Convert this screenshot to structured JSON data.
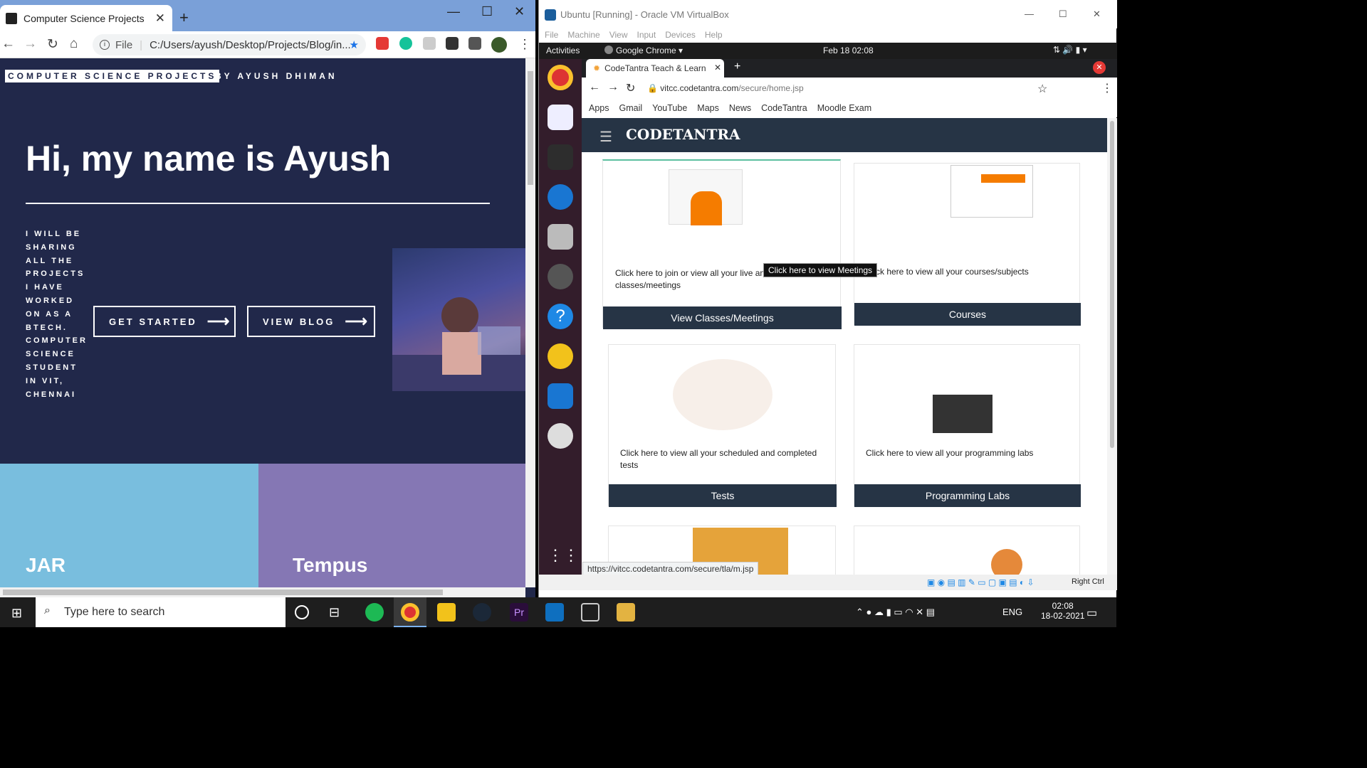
{
  "left_window": {
    "tab_title": "Computer Science Projects",
    "address": "C:/Users/ayush/Desktop/Projects/Blog/in...",
    "address_prefix": "File",
    "site": {
      "logo": "COMPUTER SCIENCE PROJECTS",
      "byline": "BY AYUSH DHIMAN",
      "hero": "Hi, my name is Ayush",
      "tagline": "I WILL BE SHARING ALL THE PROJECTS I HAVE WORKED ON AS A BTECH. COMPUTER SCIENCE STUDENT IN VIT, CHENNAI",
      "cta_primary": "GET STARTED",
      "cta_secondary": "VIEW BLOG",
      "tile_1": "JAR",
      "tile_2": "Tempus"
    }
  },
  "right_window": {
    "title": "Ubuntu [Running] - Oracle VM VirtualBox",
    "menu": [
      "File",
      "Machine",
      "View",
      "Input",
      "Devices",
      "Help"
    ],
    "gnome": {
      "activities": "Activities",
      "app": "Google Chrome ▾",
      "clock": "Feb 18  02:08"
    },
    "chrome": {
      "tab_title": "CodeTantra Teach & Learn",
      "url_host": "vitcc.codetantra.com",
      "url_path": "/secure/home.jsp",
      "bookmarks": [
        "Apps",
        "Gmail",
        "YouTube",
        "Maps",
        "News",
        "CodeTantra",
        "Moodle Exam"
      ]
    },
    "codetantra": {
      "logo": "CODETANTRA",
      "cards": [
        {
          "text": "Click here to join or view all your live and classes/meetings",
          "button": "View Classes/Meetings"
        },
        {
          "text": "Click here to view all your courses/subjects",
          "button": "Courses"
        },
        {
          "text": "Click here to view all your scheduled and completed tests",
          "button": "Tests"
        },
        {
          "text": "Click here to view all your programming labs",
          "button": "Programming Labs"
        }
      ],
      "tooltip": "Click here to view Meetings",
      "status_url": "https://vitcc.codetantra.com/secure/tla/m.jsp"
    },
    "host_key": "Right Ctrl"
  },
  "taskbar": {
    "search_placeholder": "Type here to search",
    "language": "ENG",
    "time": "02:08",
    "date": "18-02-2021"
  },
  "colors": {
    "site_bg": "#21284a",
    "tile_blue": "#79bede",
    "tile_purple": "#8577b4",
    "ct_navy": "#263445"
  }
}
